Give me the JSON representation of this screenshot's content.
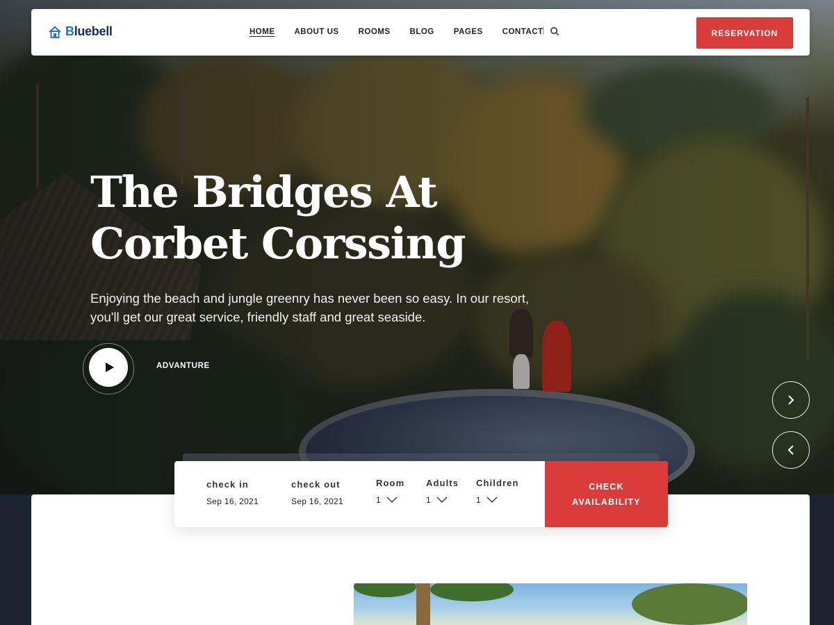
{
  "brand": {
    "name_prefix": "B",
    "name_rest": "luebell"
  },
  "nav": {
    "links": [
      "HOME",
      "ABOUT US",
      "ROOMS",
      "BLOG",
      "PAGES",
      "CONTACT"
    ],
    "active": "HOME",
    "reservation_label": "RESERVATION"
  },
  "hero": {
    "title_line1": "The Bridges At",
    "title_line2": "Corbet Corssing",
    "subtitle_line1": "Enjoying the beach and jungle greenry has never been so easy. In our resort,",
    "subtitle_line2": "you'll get our great service, friendly staff and great seaside.",
    "video_label": "ADVANTURE"
  },
  "booking": {
    "check_in_label": "check in",
    "check_in_value": "Sep 16, 2021",
    "check_out_label": "check out",
    "check_out_value": "Sep 16, 2021",
    "room_label": "Room",
    "room_value": "1",
    "adults_label": "Adults",
    "adults_value": "1",
    "children_label": "Children",
    "children_value": "1",
    "check_line1": "CHECK",
    "check_line2": "AVAILABILITY"
  },
  "colors": {
    "accent": "#d93c3b",
    "brand_blue": "#2b6fd6",
    "brand_navy": "#1a2b5a"
  },
  "icons": {
    "search": "search-icon",
    "play": "play-icon",
    "next": "chevron-right-icon",
    "prev": "chevron-left-icon",
    "dropdown": "chevron-down-icon",
    "logo": "house-logo-icon"
  }
}
